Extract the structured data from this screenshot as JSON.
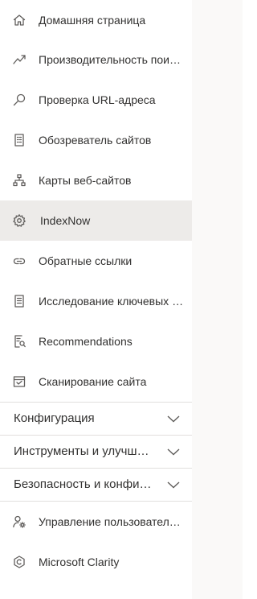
{
  "nav": {
    "items": [
      {
        "label": "Домашняя страница",
        "icon": "home-icon"
      },
      {
        "label": "Производительность поиска",
        "icon": "trending-icon"
      },
      {
        "label": "Проверка URL-адреса",
        "icon": "search-icon"
      },
      {
        "label": "Обозреватель сайтов",
        "icon": "site-explorer-icon"
      },
      {
        "label": "Карты веб-сайтов",
        "icon": "sitemap-icon"
      },
      {
        "label": "IndexNow",
        "icon": "gear-icon",
        "active": true
      },
      {
        "label": "Обратные ссылки",
        "icon": "link-icon"
      },
      {
        "label": "Исследование ключевых слов",
        "icon": "document-icon"
      },
      {
        "label": "Recommendations",
        "icon": "recommendations-icon"
      },
      {
        "label": "Сканирование сайта",
        "icon": "scan-icon"
      }
    ],
    "sections": [
      {
        "label": "Конфигурация"
      },
      {
        "label": "Инструменты и улучшения"
      },
      {
        "label": "Безопасность и конфиденциальность"
      }
    ],
    "bottom_items": [
      {
        "label": "Управление пользователями",
        "icon": "user-settings-icon"
      },
      {
        "label": "Microsoft Clarity",
        "icon": "clarity-icon"
      }
    ]
  },
  "colors": {
    "active_background": "#edebe9",
    "divider": "#e1dfdd",
    "gutter": "#faf9f8",
    "text": "#323130",
    "icon": "#605e5c"
  }
}
